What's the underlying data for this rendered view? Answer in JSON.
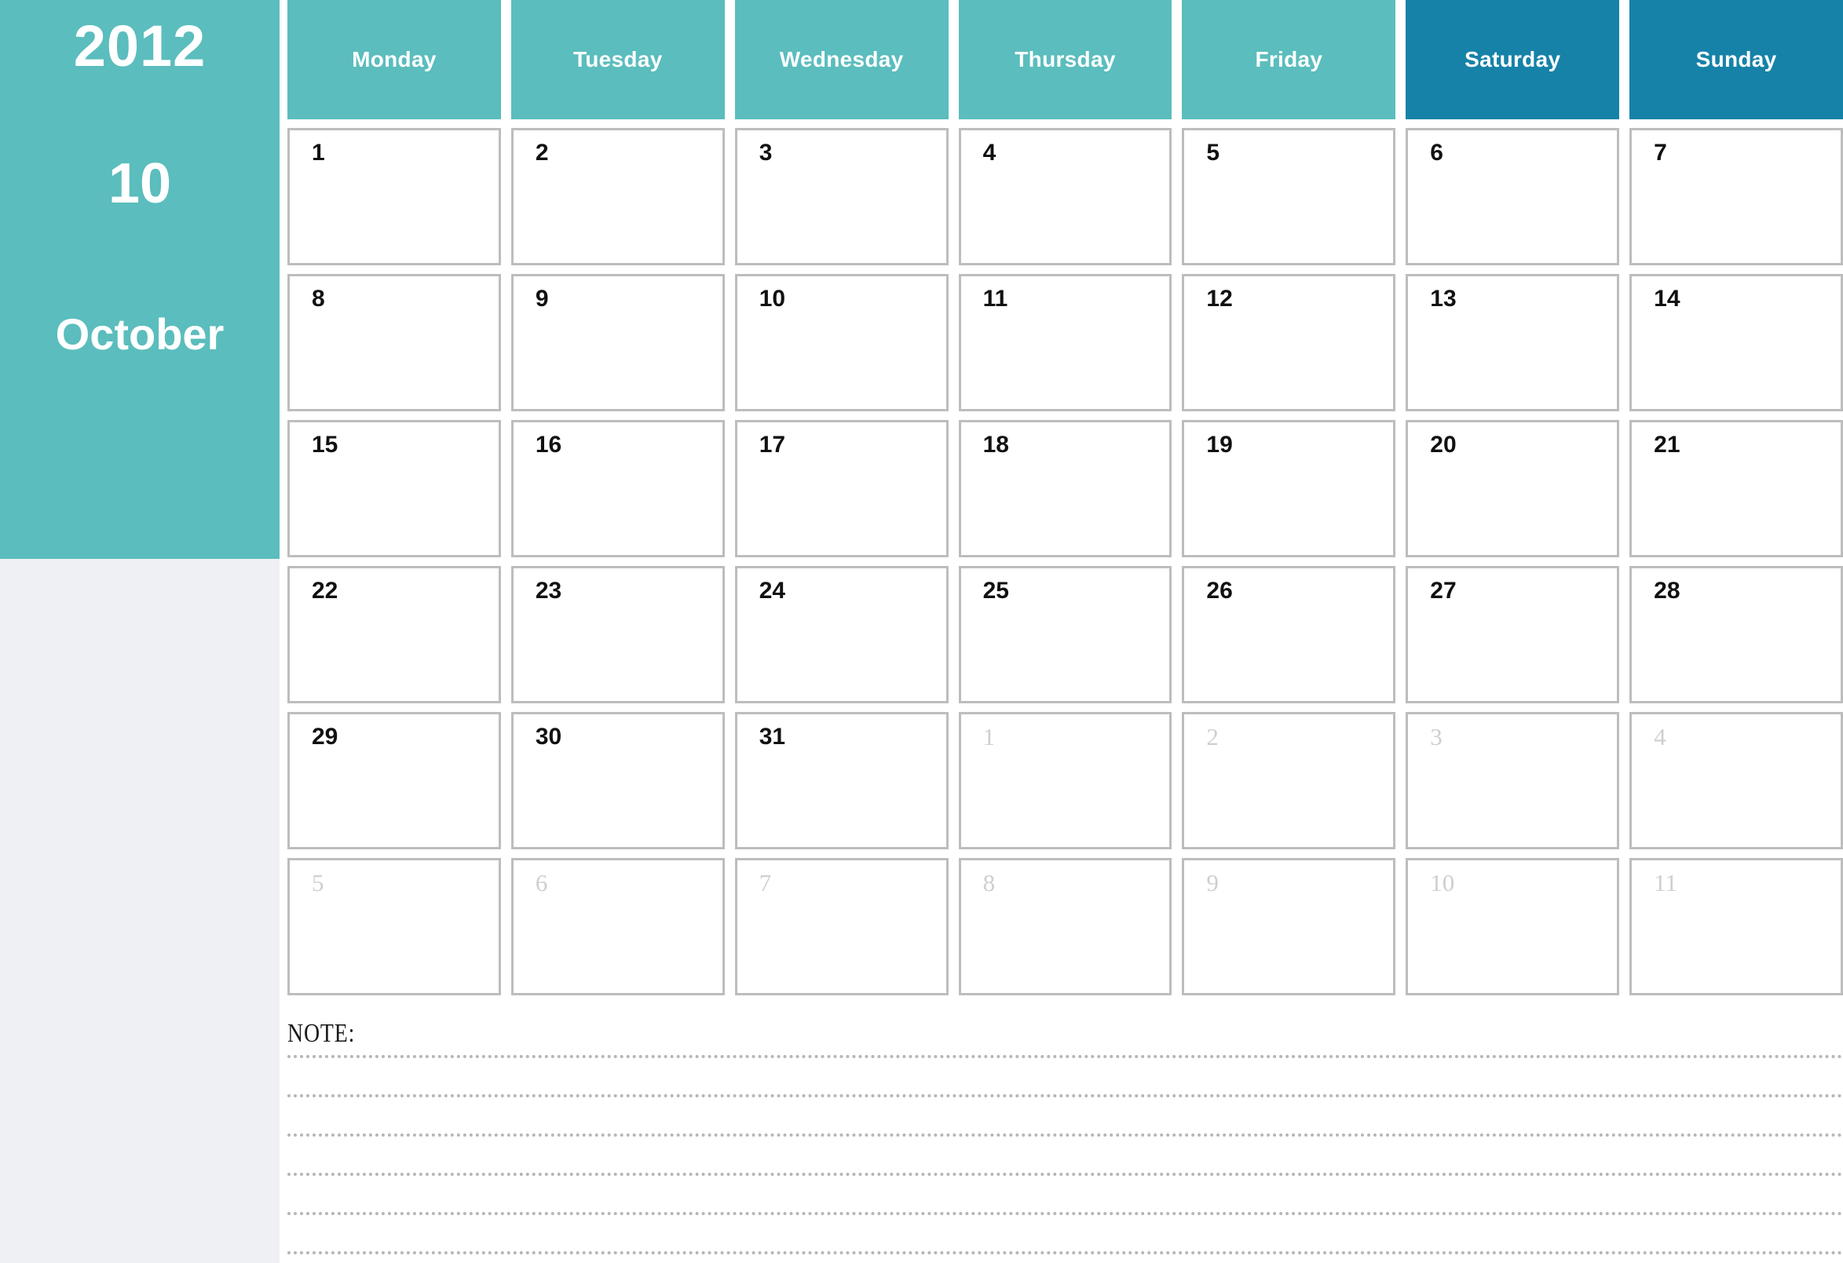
{
  "sidebar": {
    "year": "2012",
    "month_number": "10",
    "month_name": "October",
    "accent_color": "#5bbdbd",
    "weekend_color": "#1682a8",
    "panel_color": "#eff0f3"
  },
  "weekdays": [
    {
      "label": "Monday",
      "weekend": false
    },
    {
      "label": "Tuesday",
      "weekend": false
    },
    {
      "label": "Wednesday",
      "weekend": false
    },
    {
      "label": "Thursday",
      "weekend": false
    },
    {
      "label": "Friday",
      "weekend": false
    },
    {
      "label": "Saturday",
      "weekend": true
    },
    {
      "label": "Sunday",
      "weekend": true
    }
  ],
  "weeks": [
    [
      {
        "day": "1",
        "current_month": true
      },
      {
        "day": "2",
        "current_month": true
      },
      {
        "day": "3",
        "current_month": true
      },
      {
        "day": "4",
        "current_month": true
      },
      {
        "day": "5",
        "current_month": true
      },
      {
        "day": "6",
        "current_month": true
      },
      {
        "day": "7",
        "current_month": true
      }
    ],
    [
      {
        "day": "8",
        "current_month": true
      },
      {
        "day": "9",
        "current_month": true
      },
      {
        "day": "10",
        "current_month": true
      },
      {
        "day": "11",
        "current_month": true
      },
      {
        "day": "12",
        "current_month": true
      },
      {
        "day": "13",
        "current_month": true
      },
      {
        "day": "14",
        "current_month": true
      }
    ],
    [
      {
        "day": "15",
        "current_month": true
      },
      {
        "day": "16",
        "current_month": true
      },
      {
        "day": "17",
        "current_month": true
      },
      {
        "day": "18",
        "current_month": true
      },
      {
        "day": "19",
        "current_month": true
      },
      {
        "day": "20",
        "current_month": true
      },
      {
        "day": "21",
        "current_month": true
      }
    ],
    [
      {
        "day": "22",
        "current_month": true
      },
      {
        "day": "23",
        "current_month": true
      },
      {
        "day": "24",
        "current_month": true
      },
      {
        "day": "25",
        "current_month": true
      },
      {
        "day": "26",
        "current_month": true
      },
      {
        "day": "27",
        "current_month": true
      },
      {
        "day": "28",
        "current_month": true
      }
    ],
    [
      {
        "day": "29",
        "current_month": true
      },
      {
        "day": "30",
        "current_month": true
      },
      {
        "day": "31",
        "current_month": true
      },
      {
        "day": "1",
        "current_month": false
      },
      {
        "day": "2",
        "current_month": false
      },
      {
        "day": "3",
        "current_month": false
      },
      {
        "day": "4",
        "current_month": false
      }
    ],
    [
      {
        "day": "5",
        "current_month": false
      },
      {
        "day": "6",
        "current_month": false
      },
      {
        "day": "7",
        "current_month": false
      },
      {
        "day": "8",
        "current_month": false
      },
      {
        "day": "9",
        "current_month": false
      },
      {
        "day": "10",
        "current_month": false
      },
      {
        "day": "11",
        "current_month": false
      }
    ]
  ],
  "notes": {
    "label": "NOTE:",
    "line_count": 6
  }
}
